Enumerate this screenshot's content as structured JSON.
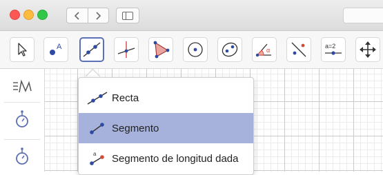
{
  "window": {
    "traffic_lights": [
      "close",
      "minimize",
      "zoom"
    ],
    "nav_icons": [
      "back-icon",
      "forward-icon"
    ],
    "sidebar_icon": "sidebar-icon"
  },
  "toolbar": {
    "tools": [
      {
        "name": "move",
        "icon": "arrow-pointer-icon"
      },
      {
        "name": "point",
        "icon": "point-icon",
        "label": "A"
      },
      {
        "name": "line",
        "icon": "line-icon",
        "selected": true
      },
      {
        "name": "perpendicular",
        "icon": "perpendicular-icon"
      },
      {
        "name": "polygon",
        "icon": "polygon-icon"
      },
      {
        "name": "circle",
        "icon": "circle-center-icon"
      },
      {
        "name": "ellipse",
        "icon": "ellipse-icon"
      },
      {
        "name": "angle",
        "icon": "angle-icon",
        "label": "α"
      },
      {
        "name": "reflect",
        "icon": "reflect-icon"
      },
      {
        "name": "slider",
        "icon": "slider-icon",
        "label": "a=2"
      },
      {
        "name": "move-graphics",
        "icon": "move-view-icon"
      }
    ]
  },
  "sidebar": {
    "items": [
      {
        "icon": "algebra-icon"
      },
      {
        "icon": "tools-icon"
      },
      {
        "icon": "tools-icon"
      }
    ]
  },
  "dropdown": {
    "items": [
      {
        "label": "Recta",
        "icon": "line-tool-icon"
      },
      {
        "label": "Segmento",
        "icon": "segment-tool-icon",
        "active": true
      },
      {
        "label": "Segmento de longitud dada",
        "icon": "segment-fixed-length-icon"
      }
    ]
  },
  "colors": {
    "accent": "#5b6fb5",
    "highlight": "#a6b2db",
    "point_blue": "#2f4aa3",
    "red": "#d0493a"
  }
}
